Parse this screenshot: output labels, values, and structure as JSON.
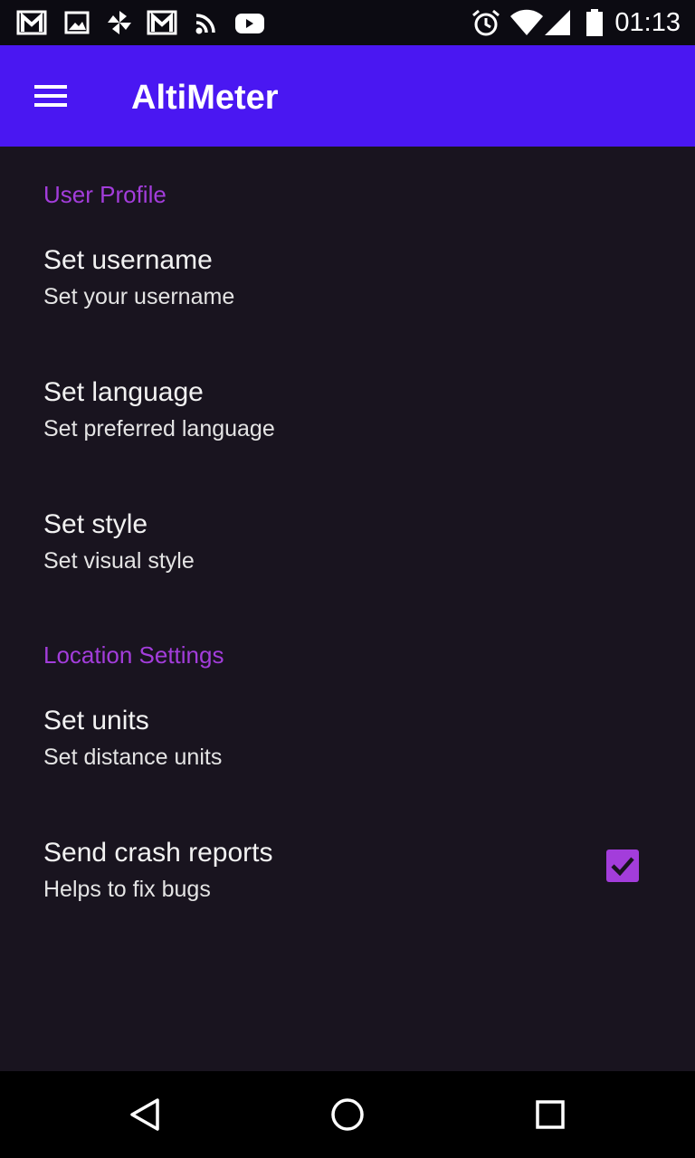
{
  "status_bar": {
    "left_icons": [
      "gmail-icon",
      "image-icon",
      "pinwheel-icon",
      "gmail-icon",
      "rss-icon",
      "youtube-icon"
    ],
    "right_icons": [
      "alarm-icon",
      "wifi-icon",
      "cell-signal-icon",
      "battery-icon"
    ],
    "time": "01:13"
  },
  "app_bar": {
    "title": "AltiMeter",
    "menu_icon": "hamburger-menu-icon",
    "color": "#4a17f2"
  },
  "sections": [
    {
      "header": "User Profile",
      "items": [
        {
          "title": "Set username",
          "summary": "Set your username"
        },
        {
          "title": "Set language",
          "summary": "Set preferred language"
        },
        {
          "title": "Set style",
          "summary": "Set visual style"
        }
      ]
    },
    {
      "header": "Location Settings",
      "items": [
        {
          "title": "Set units",
          "summary": "Set distance units"
        },
        {
          "title": "Send crash reports",
          "summary": "Helps to fix bugs",
          "checked": true
        }
      ]
    }
  ],
  "colors": {
    "accent": "#a33ddb",
    "background": "#19141f",
    "status_bar": "#0c0b12",
    "nav_bar": "#000000"
  },
  "nav_bar": {
    "buttons": [
      "back-icon",
      "home-icon",
      "recents-icon"
    ]
  }
}
